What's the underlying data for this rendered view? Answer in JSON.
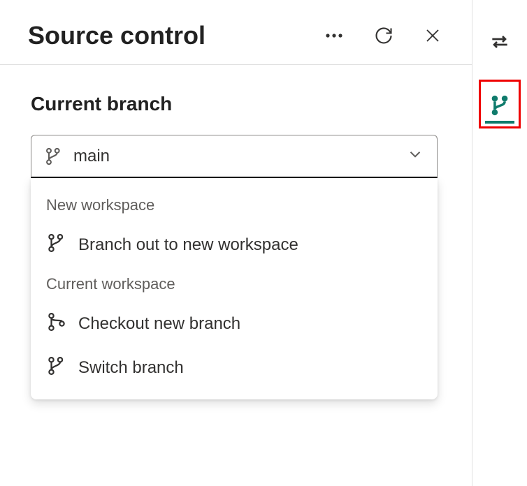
{
  "header": {
    "title": "Source control"
  },
  "section": {
    "label": "Current branch"
  },
  "dropdown": {
    "value": "main",
    "groups": [
      {
        "label": "New workspace",
        "items": [
          {
            "text": "Branch out to new workspace",
            "icon": "branch-icon"
          }
        ]
      },
      {
        "label": "Current workspace",
        "items": [
          {
            "text": "Checkout new branch",
            "icon": "branch-new-icon"
          },
          {
            "text": "Switch branch",
            "icon": "branch-icon"
          }
        ]
      }
    ]
  },
  "colors": {
    "accent": "#0f7b6c",
    "highlight": "#ef0000"
  }
}
